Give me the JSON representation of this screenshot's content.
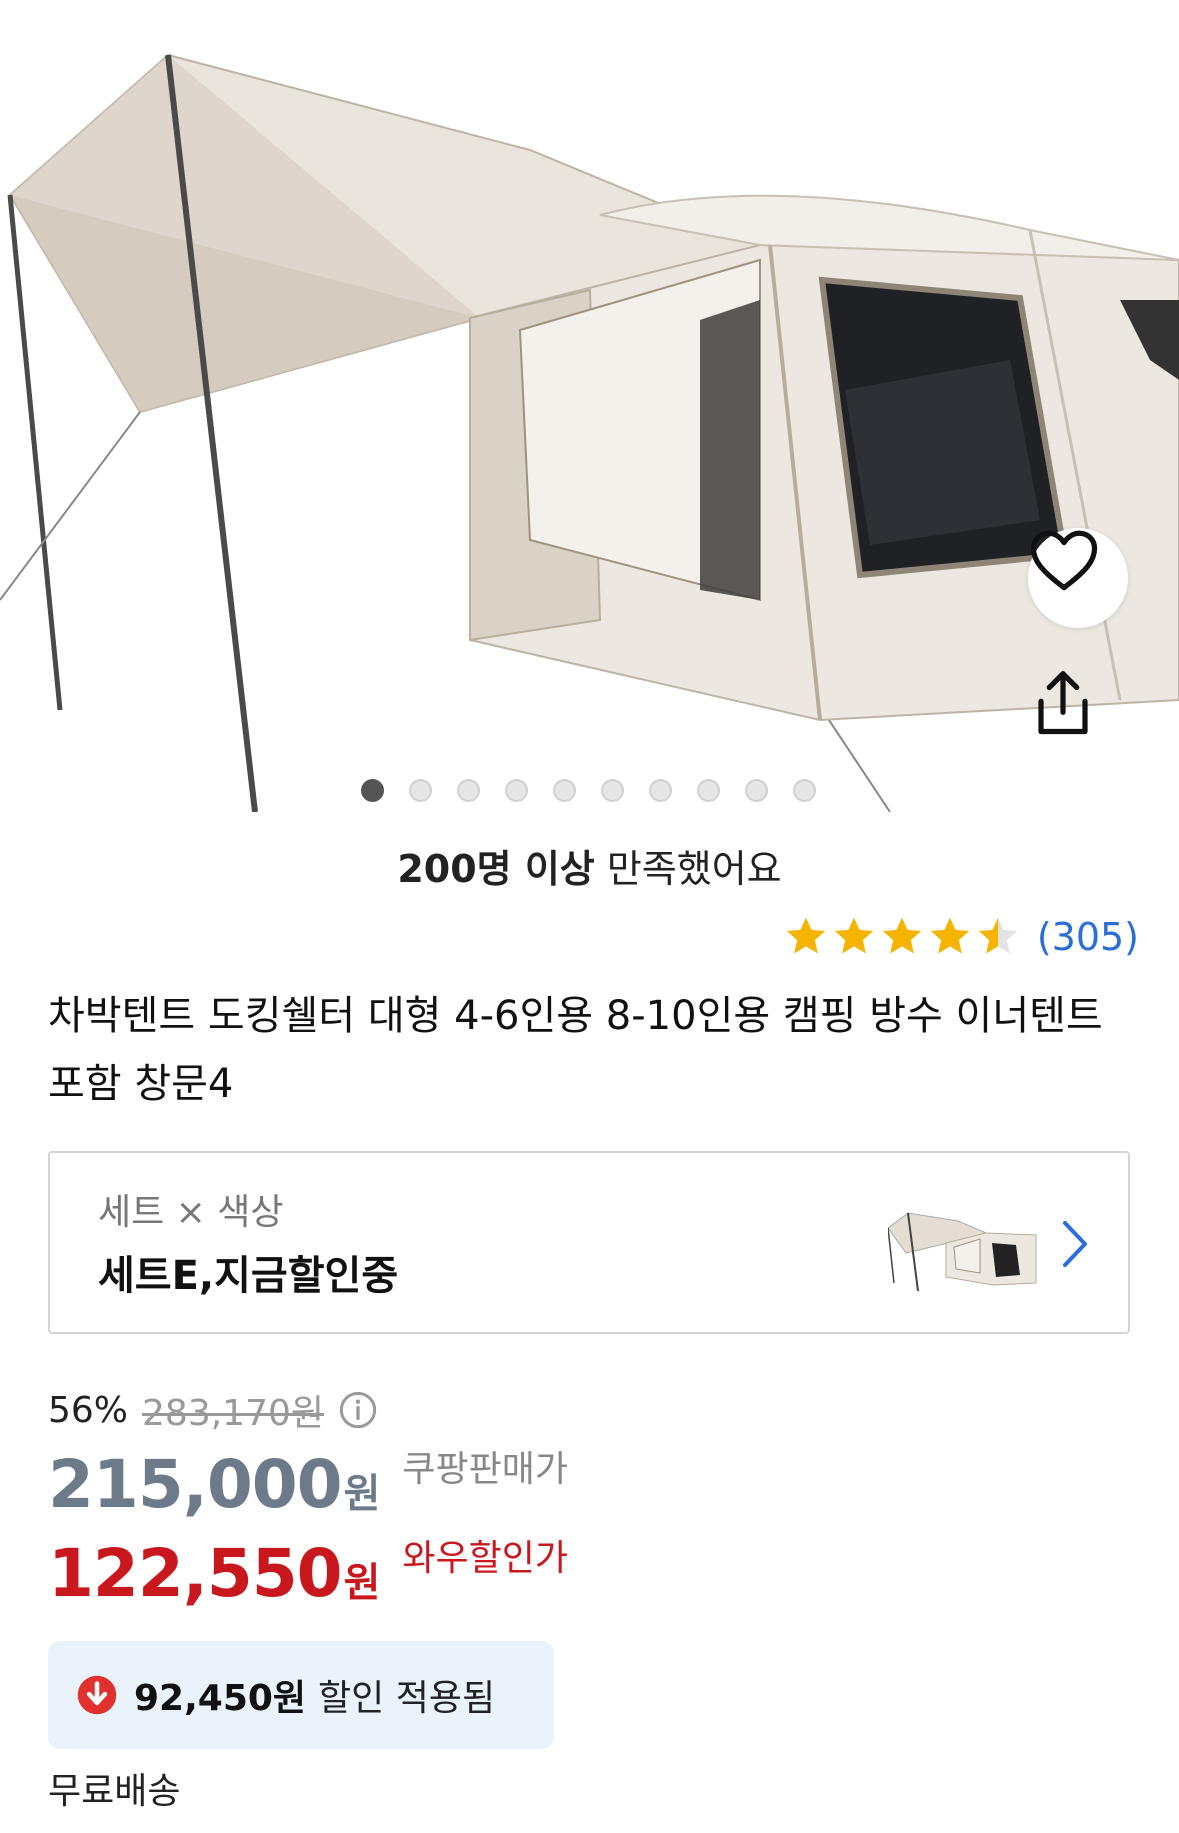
{
  "gallery": {
    "image_alt": "차박텐트 도킹쉘터",
    "dot_count": 10,
    "active_index": 0
  },
  "satisfaction": {
    "bold": "200명 이상",
    "rest": " 만족했어요"
  },
  "rating": {
    "stars": 4.5,
    "review_count": "(305)"
  },
  "product": {
    "title": "차박텐트 도킹쉘터 대형 4-6인용 8-10인용 캠핑 방수 이너텐트포함 창문4"
  },
  "option": {
    "label": "세트 × 색상",
    "value": "세트E,지금할인중"
  },
  "pricing": {
    "discount_percent": "56%",
    "original_price": "283,170원",
    "coupang_price": "215,000",
    "coupang_unit": "원",
    "coupang_label": "쿠팡판매가",
    "wow_price": "122,550",
    "wow_unit": "원",
    "wow_label": "와우할인가"
  },
  "saving": {
    "amount": "92,450원",
    "text": "할인 적용됨"
  },
  "shipping": {
    "label": "무료배송"
  },
  "colors": {
    "accent_red": "#c8181e",
    "star": "#f5b400",
    "link_blue": "#2b6fd6",
    "gray_price": "#6d7a8a"
  }
}
